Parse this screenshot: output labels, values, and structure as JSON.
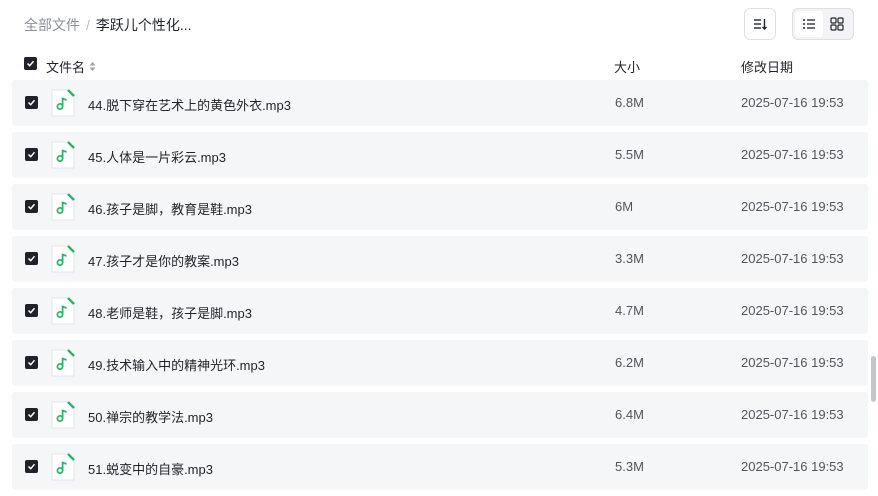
{
  "breadcrumb": {
    "root": "全部文件",
    "separator": "/",
    "current": "李跃儿个性化..."
  },
  "columns": {
    "name": "文件名",
    "size": "大小",
    "modified": "修改日期"
  },
  "colors": {
    "accent_green": "#2fb36b",
    "row_bg": "#f5f6f7",
    "checkbox": "#1f2329"
  },
  "files": [
    {
      "name": "44.脱下穿在艺术上的黄色外衣.mp3",
      "size": "6.8M",
      "date": "2025-07-16 19:53",
      "icon": "audio-file-icon",
      "checked": true
    },
    {
      "name": "45.人体是一片彩云.mp3",
      "size": "5.5M",
      "date": "2025-07-16 19:53",
      "icon": "audio-file-icon",
      "checked": true
    },
    {
      "name": "46.孩子是脚，教育是鞋.mp3",
      "size": "6M",
      "date": "2025-07-16 19:53",
      "icon": "audio-file-icon",
      "checked": true
    },
    {
      "name": "47.孩子才是你的教案.mp3",
      "size": "3.3M",
      "date": "2025-07-16 19:53",
      "icon": "audio-file-icon",
      "checked": true
    },
    {
      "name": "48.老师是鞋，孩子是脚.mp3",
      "size": "4.7M",
      "date": "2025-07-16 19:53",
      "icon": "audio-file-icon",
      "checked": true
    },
    {
      "name": "49.技术输入中的精神光环.mp3",
      "size": "6.2M",
      "date": "2025-07-16 19:53",
      "icon": "audio-file-icon",
      "checked": true
    },
    {
      "name": "50.禅宗的教学法.mp3",
      "size": "6.4M",
      "date": "2025-07-16 19:53",
      "icon": "audio-file-icon",
      "checked": true
    },
    {
      "name": "51.蜕变中的自豪.mp3",
      "size": "5.3M",
      "date": "2025-07-16 19:53",
      "icon": "audio-file-icon",
      "checked": true
    }
  ]
}
